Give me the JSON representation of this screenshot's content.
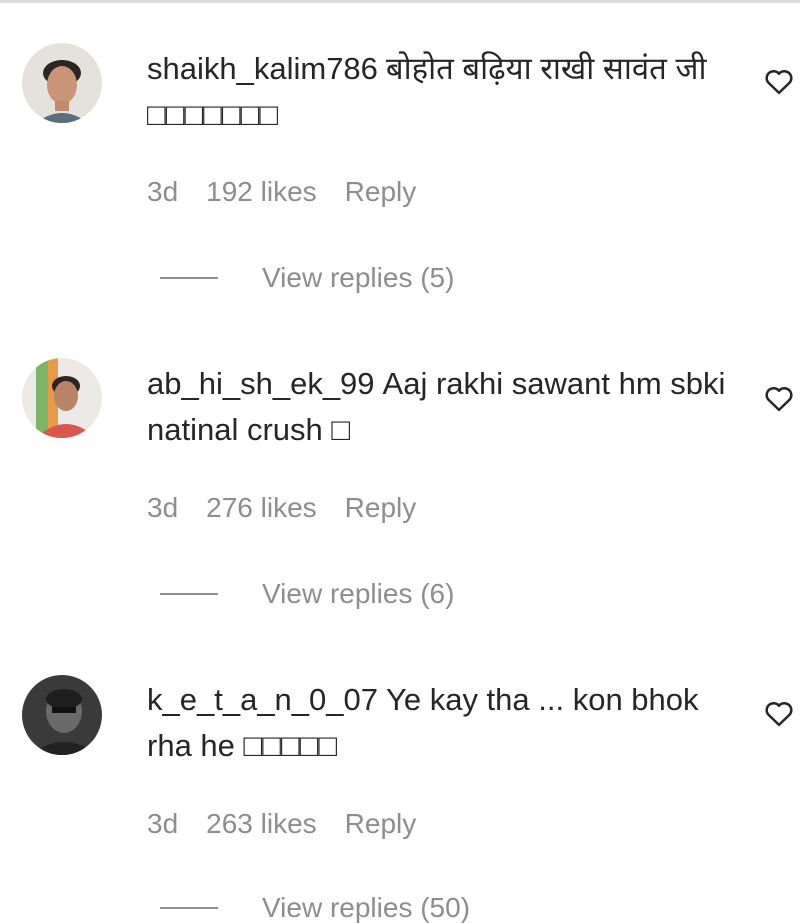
{
  "comments": [
    {
      "username": "shaikh_kalim786",
      "text": "बोहोत बढ़िया राखी सावंत जी □□□□□□□",
      "age": "3d",
      "likes": "192 likes",
      "reply_label": "Reply",
      "view_replies": "View replies (5)",
      "like_icon": "heart-outline-icon"
    },
    {
      "username": "ab_hi_sh_ek_99",
      "text": "Aaj rakhi sawant hm sbki natinal crush □",
      "age": "3d",
      "likes": "276 likes",
      "reply_label": "Reply",
      "view_replies": "View replies (6)",
      "like_icon": "heart-outline-icon"
    },
    {
      "username": "k_e_t_a_n_0_07",
      "text": "Ye kay tha ... kon bhok rha he □□□□□",
      "age": "3d",
      "likes": "263 likes",
      "reply_label": "Reply",
      "view_replies": "View replies (50)",
      "like_icon": "heart-outline-icon"
    }
  ],
  "colors": {
    "text": "#262626",
    "secondary": "#8e8e8e",
    "divider": "#dbdbdb"
  }
}
